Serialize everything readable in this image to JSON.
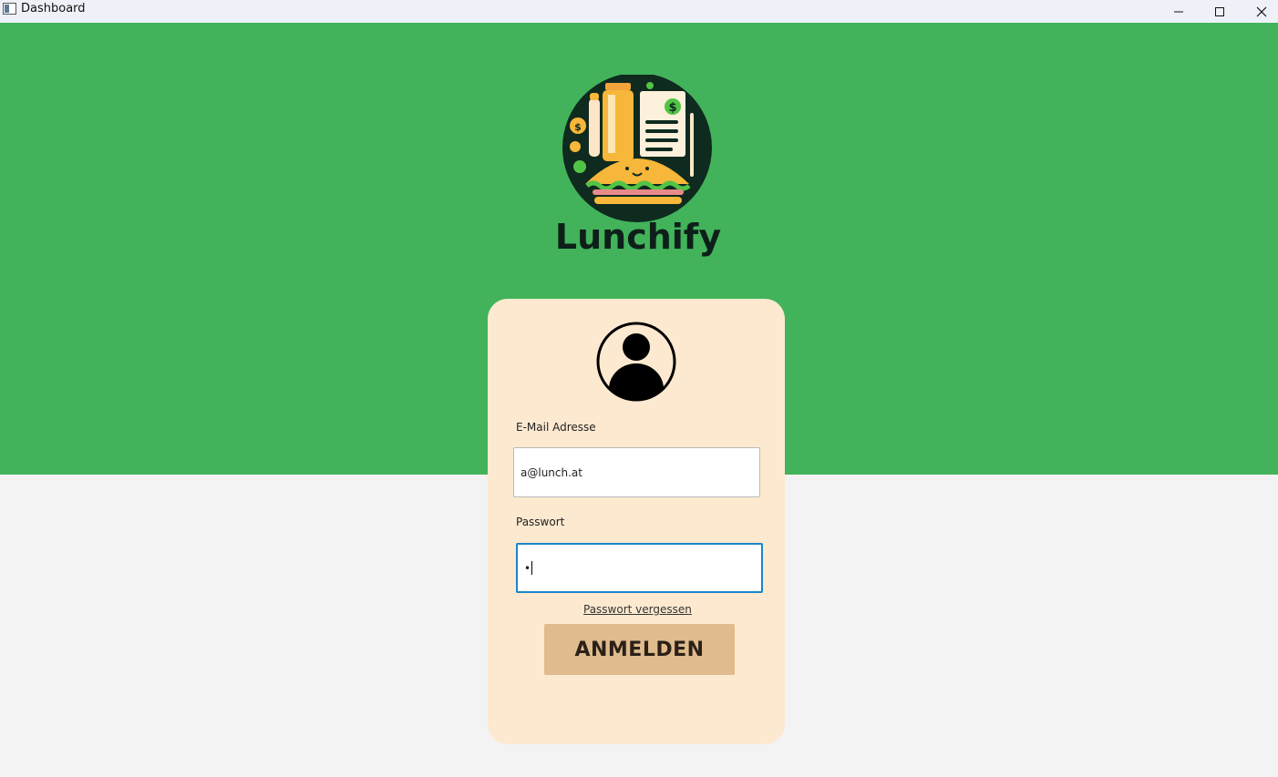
{
  "window": {
    "title": "Dashboard",
    "controls": {
      "minimize": "minimize-icon",
      "maximize": "maximize-icon",
      "close": "close-icon"
    }
  },
  "brand": {
    "name": "Lunchify",
    "logo": "lunchify-logo",
    "colors": {
      "header_green": "#42b35a",
      "card_cream": "#fde9d0",
      "button_tan": "#dfbb8d",
      "focus_blue": "#1a86c9"
    }
  },
  "login": {
    "avatar_icon": "user-avatar-icon",
    "email_label": "E-Mail Adresse",
    "email_value": "a@lunch.at",
    "password_label": "Passwort",
    "password_value": "•",
    "forgot_link": "Passwort vergessen",
    "submit_label": "ANMELDEN"
  }
}
